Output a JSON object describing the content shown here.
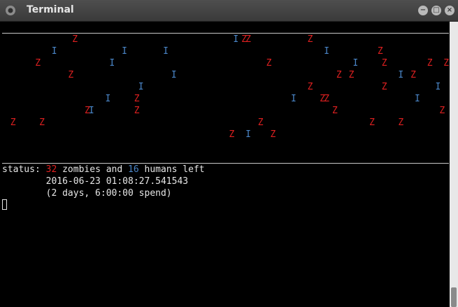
{
  "window": {
    "title": "Terminal"
  },
  "grid": {
    "rows": [
      "                 Z                                      I ZZ              Z",
      "            I                I         I                                      I            Z",
      "        Z                 I                                     Z                    I      Z          Z   Z",
      "                Z                        I                                       Z  Z           I  Z",
      "                                 I                                        Z                 Z            I",
      "                         I      Z                                     I      ZZ                     I",
      "                    ZI          Z                                               Z                         Z",
      "  Z      Z                                                    Z                          Z      Z",
      "                                                       Z   I     Z"
    ]
  },
  "status": {
    "prefix": "status: ",
    "zombies": "32",
    "mid": " zombies and ",
    "humans": "16",
    "suffix": " humans left",
    "timestamp": "        2016-06-23 01:08:27.541543",
    "elapsed": "        (2 days, 6:00:00 spend)"
  },
  "colors": {
    "zombie": "#e02020",
    "human": "#4a86c8",
    "text": "#e6e6e6",
    "background": "#000000"
  }
}
